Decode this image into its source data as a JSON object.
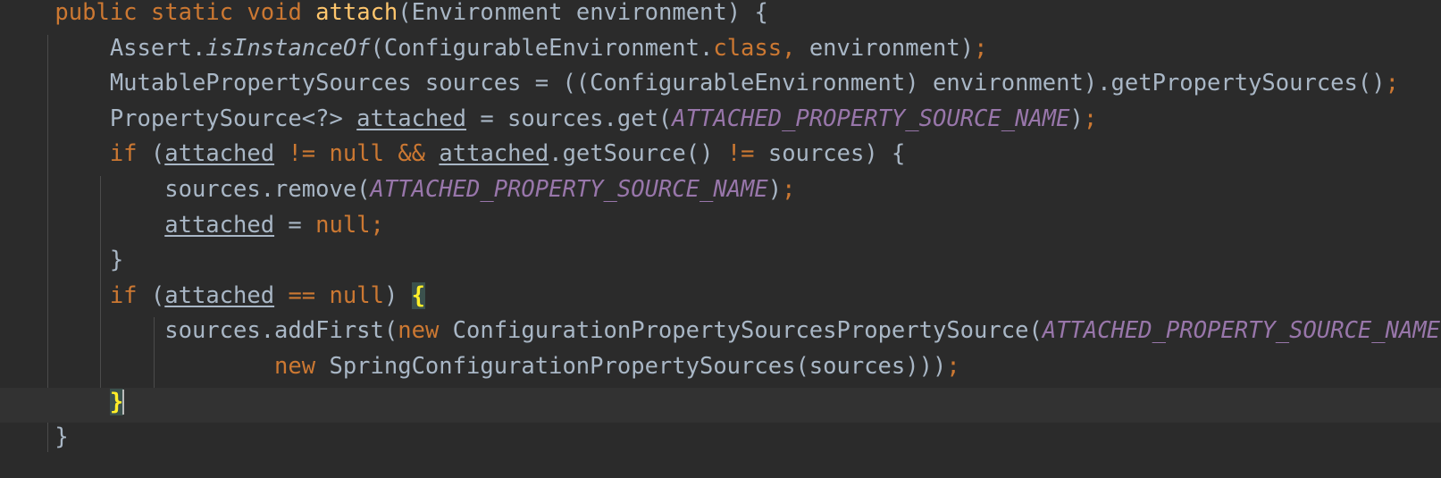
{
  "editor": {
    "language": "Java",
    "theme": "Darcula",
    "colors": {
      "background": "#2b2b2b",
      "current_line_background": "#323232",
      "default_text": "#a9b7c6",
      "keyword": "#cc7832",
      "method_declaration": "#ffc66d",
      "static_constant": "#9876aa",
      "brace_match_background": "#3b514d",
      "brace_match_text": "#ffef28",
      "indent_guide": "#4b4b4b",
      "caret": "#bbbbbb"
    },
    "caret_line_index": 11,
    "caret_column_after": "}",
    "indent_guide_x": [
      53,
      112,
      172
    ],
    "line_height": 39.6,
    "font_size": 25.5
  },
  "code": {
    "lines": [
      {
        "index": 0,
        "text": "    public static void attach(Environment environment) {",
        "tokens": [
          {
            "t": "    ",
            "c": "indent"
          },
          {
            "t": "public",
            "c": "kw"
          },
          {
            "t": " ",
            "c": "def"
          },
          {
            "t": "static",
            "c": "kw"
          },
          {
            "t": " ",
            "c": "def"
          },
          {
            "t": "void",
            "c": "kw"
          },
          {
            "t": " ",
            "c": "def"
          },
          {
            "t": "attach",
            "c": "mdecl"
          },
          {
            "t": "(Environment environment) {",
            "c": "def"
          }
        ]
      },
      {
        "index": 1,
        "text": "        Assert.isInstanceOf(ConfigurableEnvironment.class, environment);",
        "tokens": [
          {
            "t": "        ",
            "c": "indent"
          },
          {
            "t": "Assert.",
            "c": "def"
          },
          {
            "t": "isInstanceOf",
            "c": "static-m"
          },
          {
            "t": "(ConfigurableEnvironment.",
            "c": "def"
          },
          {
            "t": "class",
            "c": "kw"
          },
          {
            "t": ",",
            "c": "semi"
          },
          {
            "t": " environment)",
            "c": "def"
          },
          {
            "t": ";",
            "c": "semi"
          }
        ]
      },
      {
        "index": 2,
        "text": "        MutablePropertySources sources = ((ConfigurableEnvironment) environment).getPropertySources();",
        "tokens": [
          {
            "t": "        ",
            "c": "indent"
          },
          {
            "t": "MutablePropertySources sources = ((ConfigurableEnvironment) environment).getPropertySources()",
            "c": "def"
          },
          {
            "t": ";",
            "c": "semi"
          }
        ]
      },
      {
        "index": 3,
        "text": "        PropertySource<?> attached = sources.get(ATTACHED_PROPERTY_SOURCE_NAME);",
        "tokens": [
          {
            "t": "        ",
            "c": "indent"
          },
          {
            "t": "PropertySource<?> ",
            "c": "def"
          },
          {
            "t": "attached",
            "c": "local"
          },
          {
            "t": " = sources.get(",
            "c": "def"
          },
          {
            "t": "ATTACHED_PROPERTY_SOURCE_NAME",
            "c": "const"
          },
          {
            "t": ")",
            "c": "def"
          },
          {
            "t": ";",
            "c": "semi"
          }
        ]
      },
      {
        "index": 4,
        "text": "        if (attached != null && attached.getSource() != sources) {",
        "tokens": [
          {
            "t": "        ",
            "c": "indent"
          },
          {
            "t": "if",
            "c": "kw"
          },
          {
            "t": " (",
            "c": "def"
          },
          {
            "t": "attached",
            "c": "local"
          },
          {
            "t": " ",
            "c": "def"
          },
          {
            "t": "!=",
            "c": "semi"
          },
          {
            "t": " ",
            "c": "def"
          },
          {
            "t": "null",
            "c": "kw"
          },
          {
            "t": " ",
            "c": "def"
          },
          {
            "t": "&&",
            "c": "semi"
          },
          {
            "t": " ",
            "c": "def"
          },
          {
            "t": "attached",
            "c": "local"
          },
          {
            "t": ".getSource() ",
            "c": "def"
          },
          {
            "t": "!=",
            "c": "semi"
          },
          {
            "t": " sources) {",
            "c": "def"
          }
        ]
      },
      {
        "index": 5,
        "text": "            sources.remove(ATTACHED_PROPERTY_SOURCE_NAME);",
        "tokens": [
          {
            "t": "            ",
            "c": "indent"
          },
          {
            "t": "sources.remove(",
            "c": "def"
          },
          {
            "t": "ATTACHED_PROPERTY_SOURCE_NAME",
            "c": "const"
          },
          {
            "t": ")",
            "c": "def"
          },
          {
            "t": ";",
            "c": "semi"
          }
        ]
      },
      {
        "index": 6,
        "text": "            attached = null;",
        "tokens": [
          {
            "t": "            ",
            "c": "indent"
          },
          {
            "t": "attached",
            "c": "local"
          },
          {
            "t": " = ",
            "c": "def"
          },
          {
            "t": "null",
            "c": "kw"
          },
          {
            "t": ";",
            "c": "semi"
          }
        ]
      },
      {
        "index": 7,
        "text": "        }",
        "tokens": [
          {
            "t": "        ",
            "c": "indent"
          },
          {
            "t": "}",
            "c": "def"
          }
        ]
      },
      {
        "index": 8,
        "text": "        if (attached == null) {",
        "tokens": [
          {
            "t": "        ",
            "c": "indent"
          },
          {
            "t": "if",
            "c": "kw"
          },
          {
            "t": " (",
            "c": "def"
          },
          {
            "t": "attached",
            "c": "local"
          },
          {
            "t": " ",
            "c": "def"
          },
          {
            "t": "==",
            "c": "semi"
          },
          {
            "t": " ",
            "c": "def"
          },
          {
            "t": "null",
            "c": "kw"
          },
          {
            "t": ") ",
            "c": "def"
          },
          {
            "t": "{",
            "c": "brace-match"
          }
        ]
      },
      {
        "index": 9,
        "text": "            sources.addFirst(new ConfigurationPropertySourcesPropertySource(ATTACHED_PROPERTY_SOURCE_NAME,",
        "tokens": [
          {
            "t": "            ",
            "c": "indent"
          },
          {
            "t": "sources.addFirst(",
            "c": "def"
          },
          {
            "t": "new",
            "c": "kw"
          },
          {
            "t": " ConfigurationPropertySourcesPropertySource(",
            "c": "def"
          },
          {
            "t": "ATTACHED_PROPERTY_SOURCE_NAME",
            "c": "const"
          },
          {
            "t": ",",
            "c": "semi"
          }
        ]
      },
      {
        "index": 10,
        "text": "                    new SpringConfigurationPropertySources(sources)));",
        "tokens": [
          {
            "t": "                    ",
            "c": "indent"
          },
          {
            "t": "new",
            "c": "kw"
          },
          {
            "t": " SpringConfigurationPropertySources(sources)))",
            "c": "def"
          },
          {
            "t": ";",
            "c": "semi"
          }
        ]
      },
      {
        "index": 11,
        "text": "        }",
        "current": true,
        "tokens": [
          {
            "t": "        ",
            "c": "indent"
          },
          {
            "t": "}",
            "c": "brace-match"
          },
          {
            "t": "",
            "c": "caret"
          }
        ]
      },
      {
        "index": 12,
        "text": "    }",
        "tokens": [
          {
            "t": "    ",
            "c": "indent"
          },
          {
            "t": "}",
            "c": "def"
          }
        ]
      }
    ]
  }
}
